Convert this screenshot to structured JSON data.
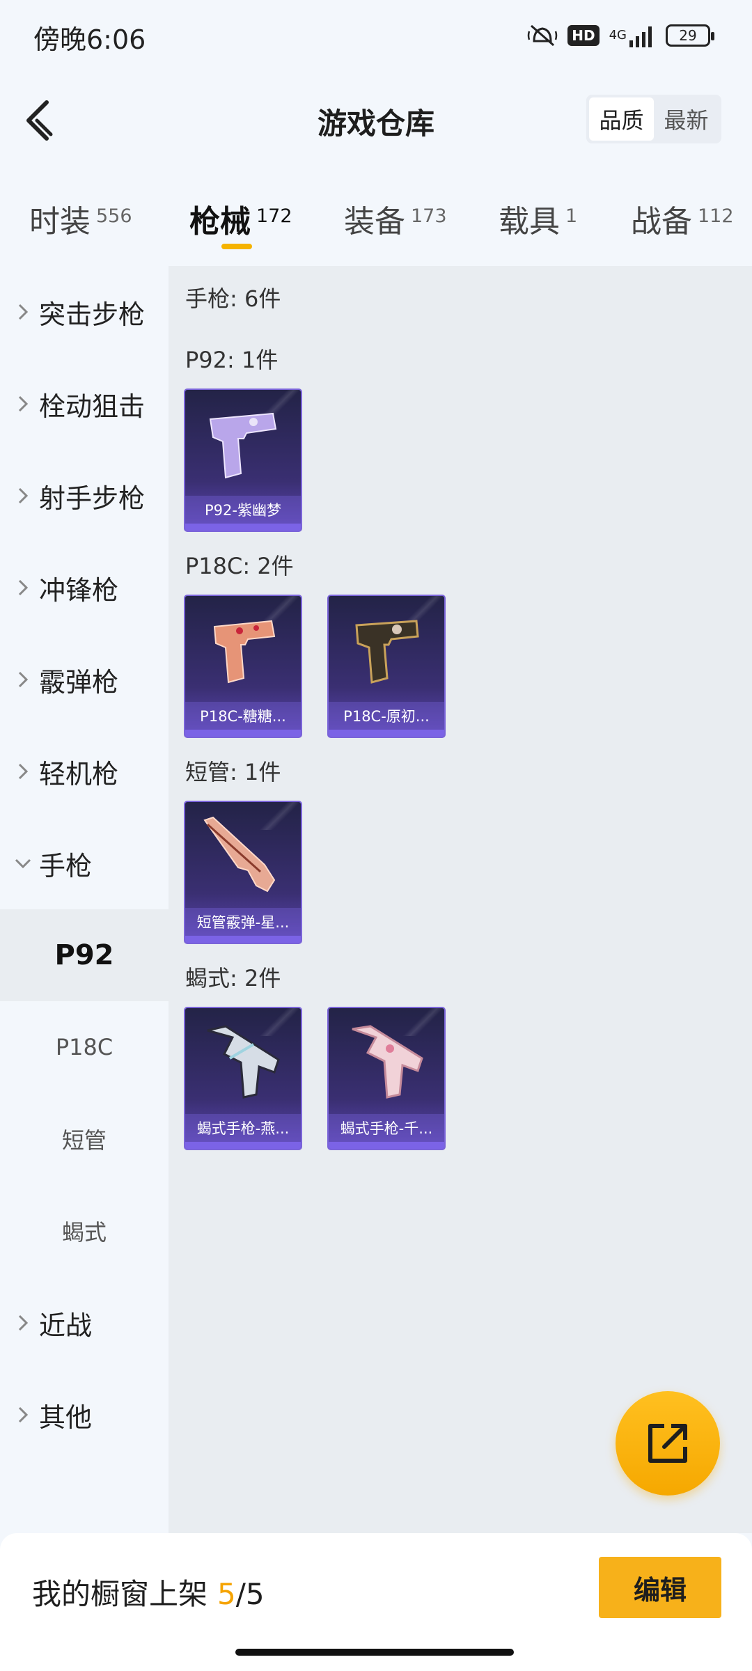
{
  "status_bar": {
    "time": "傍晚6:06",
    "icons": [
      "mute-vibrate-icon",
      "hd-icon",
      "signal-icon",
      "battery-icon"
    ],
    "hd": "HD",
    "network": "4G",
    "battery": "29"
  },
  "header": {
    "title": "游戏仓库",
    "back_icon": "chevron-left-icon",
    "sort_options": [
      "品质",
      "最新"
    ],
    "sort_active": "品质"
  },
  "tabs": [
    {
      "label": "时装",
      "count": "556"
    },
    {
      "label": "枪械",
      "count": "172",
      "active": true
    },
    {
      "label": "装备",
      "count": "173"
    },
    {
      "label": "载具",
      "count": "1"
    },
    {
      "label": "战备",
      "count": "112"
    }
  ],
  "sidebar": {
    "categories": [
      {
        "label": "突击步枪",
        "expanded": false
      },
      {
        "label": "栓动狙击",
        "expanded": false
      },
      {
        "label": "射手步枪",
        "expanded": false
      },
      {
        "label": "冲锋枪",
        "expanded": false
      },
      {
        "label": "霰弹枪",
        "expanded": false
      },
      {
        "label": "轻机枪",
        "expanded": false
      },
      {
        "label": "手枪",
        "expanded": true
      },
      {
        "label": "近战",
        "expanded": false
      },
      {
        "label": "其他",
        "expanded": false
      }
    ],
    "subcategories": [
      {
        "label": "P92",
        "active": true
      },
      {
        "label": "P18C"
      },
      {
        "label": "短管"
      },
      {
        "label": "蝎式"
      }
    ]
  },
  "content": {
    "total_label": "手枪: 6件",
    "groups": [
      {
        "title": "P92: 1件",
        "items": [
          "P92-紫幽梦"
        ]
      },
      {
        "title": "P18C: 2件",
        "items": [
          "P18C-糖糖...",
          "P18C-原初..."
        ]
      },
      {
        "title": "短管: 1件",
        "items": [
          "短管霰弹-星..."
        ]
      },
      {
        "title": "蝎式: 2件",
        "items": [
          "蝎式手枪-燕...",
          "蝎式手枪-千..."
        ]
      }
    ]
  },
  "fab": {
    "icon": "share-external-icon"
  },
  "bottom_bar": {
    "label": "我的橱窗上架",
    "count_now": "5",
    "count_sep": "/",
    "count_total": "5",
    "edit_label": "编辑"
  },
  "colors": {
    "accent": "#f5b300",
    "card_bottom": "#7b63e6",
    "content_bg": "#e9edf1",
    "page_bg": "#f3f7fc"
  }
}
